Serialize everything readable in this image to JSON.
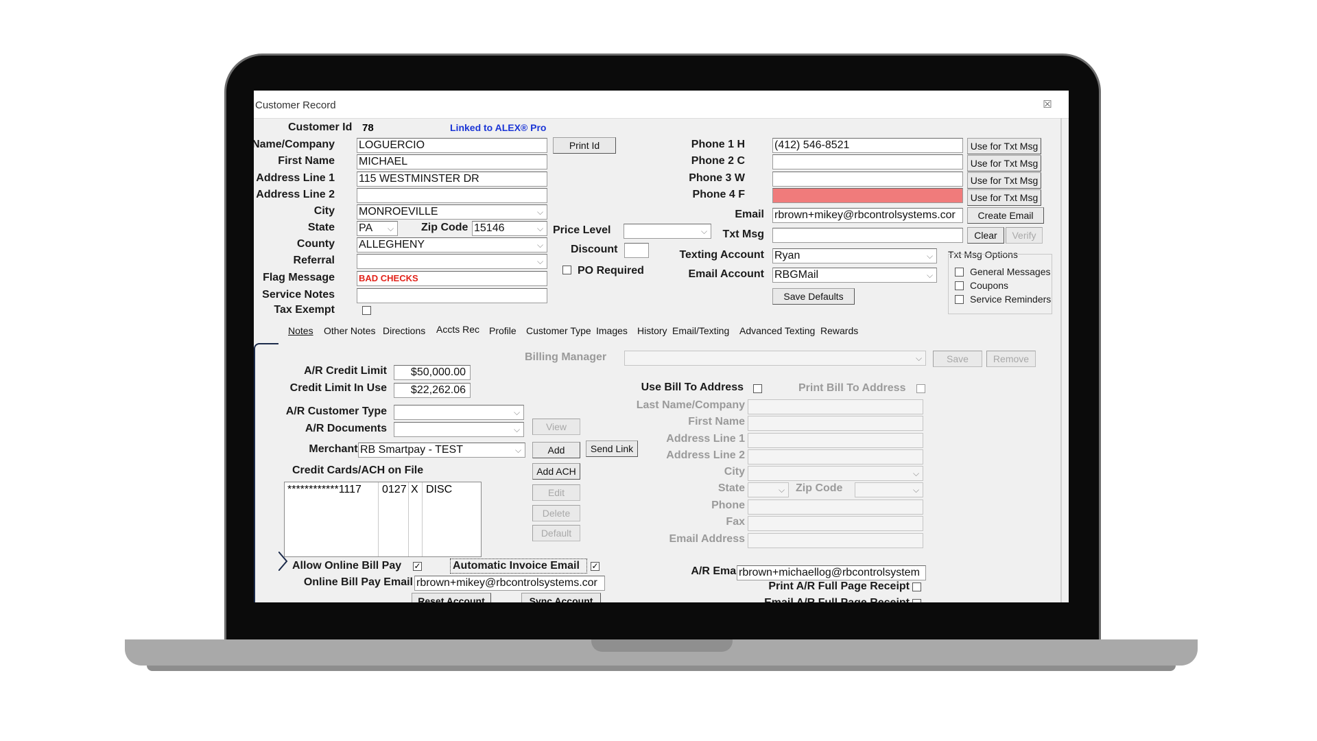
{
  "window": {
    "title": "Customer Record"
  },
  "header": {
    "customer_id_label": "Customer Id",
    "customer_id_value": "78",
    "linked_text": "Linked to ALEX® Pro",
    "print_id": "Print Id"
  },
  "left": {
    "last_name_label": "st Name/Company",
    "last_name": "LOGUERCIO",
    "first_name_label": "First Name",
    "first_name": "MICHAEL",
    "addr1_label": "Address Line 1",
    "addr1": "115 WESTMINSTER DR",
    "addr2_label": "Address Line 2",
    "addr2": "",
    "city_label": "City",
    "city": "MONROEVILLE",
    "state_label": "State",
    "state": "PA",
    "zip_label": "Zip Code",
    "zip": "15146",
    "county_label": "County",
    "county": "ALLEGHENY",
    "referral_label": "Referral",
    "referral": "",
    "flag_label": "Flag Message",
    "flag": "BAD CHECKS",
    "service_notes_label": "Service Notes",
    "service_notes": "",
    "tax_exempt_label": "Tax Exempt"
  },
  "middle": {
    "price_level_label": "Price Level",
    "price_level": "",
    "discount_label": "Discount",
    "discount": "",
    "po_required_label": "PO Required"
  },
  "right": {
    "phone1_label": "Phone 1 H",
    "phone1": "(412) 546-8521",
    "phone2_label": "Phone 2 C",
    "phone2": "",
    "phone3_label": "Phone 3 W",
    "phone3": "",
    "phone4_label": "Phone 4 F",
    "phone4": "",
    "use_for_txt": "Use for Txt Msg",
    "email_label": "Email",
    "email": "rbrown+mikey@rbcontrolsystems.cor",
    "create_email": "Create Email",
    "txt_msg_label": "Txt Msg",
    "txt_msg": "",
    "clear": "Clear",
    "verify": "Verify",
    "texting_account_label": "Texting Account",
    "texting_account": "Ryan",
    "email_account_label": "Email Account",
    "email_account": "RBGMail",
    "save_defaults": "Save Defaults",
    "txt_options_title": "Txt Msg Options",
    "opt_general": "General Messages",
    "opt_coupons": "Coupons",
    "opt_service": "Service Reminders"
  },
  "tabs": [
    "Notes",
    "Other Notes",
    "Directions",
    "Accts Rec",
    "Profile",
    "Customer Type",
    "Images",
    "History",
    "Email/Texting",
    "Advanced Texting",
    "Rewards"
  ],
  "ar": {
    "billing_manager_label": "Billing Manager",
    "billing_manager": "",
    "save": "Save",
    "remove": "Remove",
    "credit_limit_label": "A/R Credit Limit",
    "credit_limit": "$50,000.00",
    "credit_in_use_label": "Credit Limit In Use",
    "credit_in_use": "$22,262.06",
    "customer_type_label": "A/R Customer Type",
    "customer_type": "",
    "documents_label": "A/R Documents",
    "documents": "",
    "view": "View",
    "merchant_label": "Merchant ID",
    "merchant": "RB Smartpay - TEST",
    "add": "Add",
    "send_link": "Send Link",
    "cards_label": "Credit Cards/ACH on File",
    "add_ach": "Add ACH",
    "edit": "Edit",
    "delete": "Delete",
    "default": "Default",
    "card_row": {
      "number": "************1117",
      "exp": "0127",
      "flag": "X",
      "type": "DISC"
    },
    "allow_online_label": "Allow Online Bill Pay",
    "auto_invoice_label": "Automatic Invoice Email",
    "online_email_label": "Online Bill Pay Email",
    "online_email": "rbrown+mikey@rbcontrolsystems.cor",
    "reset_account": "Reset Account",
    "sync_account": "Sync Account",
    "use_bill_to_label": "Use Bill To Address",
    "print_bill_to_label": "Print Bill To Address",
    "bt_last_label": "Last Name/Company",
    "bt_first_label": "First Name",
    "bt_addr1_label": "Address Line 1",
    "bt_addr2_label": "Address Line 2",
    "bt_city_label": "City",
    "bt_state_label": "State",
    "bt_zip_label": "Zip Code",
    "bt_phone_label": "Phone",
    "bt_fax_label": "Fax",
    "bt_email_label": "Email Address",
    "ar_email_label": "A/R Email",
    "ar_email": "rbrown+michaellog@rbcontrolsystem",
    "print_full_label": "Print A/R Full Page Receipt",
    "email_full_label": "Email A/R Full Page Receipt"
  },
  "colors": {
    "link": "#1a35d6",
    "flag": "#e2231a",
    "phone4_bg": "#f07b7b"
  }
}
